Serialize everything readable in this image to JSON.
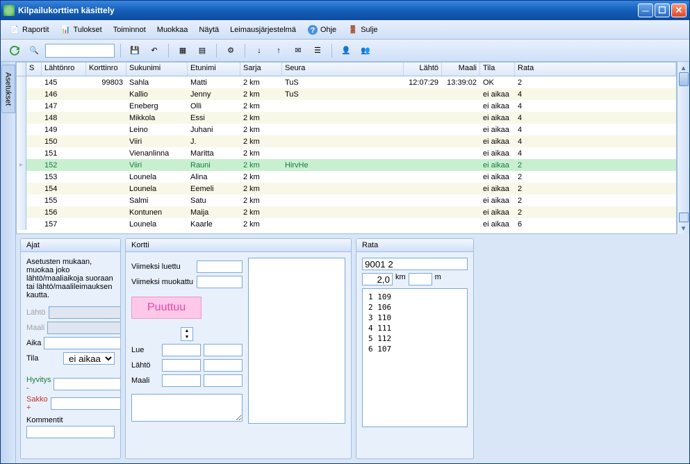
{
  "window": {
    "title": "Kilpailukorttien käsittely"
  },
  "menu": {
    "raportit": "Raportit",
    "tulokset": "Tulokset",
    "toiminnot": "Toiminnot",
    "muokkaa": "Muokkaa",
    "nayta": "Näytä",
    "leimaus": "Leimausjärjestelmä",
    "ohje": "Ohje",
    "sulje": "Sulje"
  },
  "grid": {
    "headers": {
      "s": "S",
      "lahtonro": "Lähtönro",
      "korttinro": "Korttinro",
      "sukunimi": "Sukunimi",
      "etunimi": "Etunimi",
      "sarja": "Sarja",
      "seura": "Seura",
      "lahto": "Lähtö",
      "maali": "Maali",
      "tila": "Tila",
      "rata": "Rata"
    },
    "rows": [
      {
        "lahtonro": "145",
        "korttinro": "99803",
        "sukunimi": "Sahla",
        "etunimi": "Matti",
        "sarja": "2 km",
        "seura": "TuS",
        "lahto": "12:07:29",
        "maali": "13:39:02",
        "tila": "OK",
        "rata": "2"
      },
      {
        "lahtonro": "146",
        "korttinro": "",
        "sukunimi": "Kallio",
        "etunimi": "Jenny",
        "sarja": "2 km",
        "seura": "TuS",
        "lahto": "",
        "maali": "",
        "tila": "ei aikaa",
        "rata": "4"
      },
      {
        "lahtonro": "147",
        "korttinro": "",
        "sukunimi": "Eneberg",
        "etunimi": "Olli",
        "sarja": "2 km",
        "seura": "",
        "lahto": "",
        "maali": "",
        "tila": "ei aikaa",
        "rata": "4"
      },
      {
        "lahtonro": "148",
        "korttinro": "",
        "sukunimi": "Mikkola",
        "etunimi": "Essi",
        "sarja": "2 km",
        "seura": "",
        "lahto": "",
        "maali": "",
        "tila": "ei aikaa",
        "rata": "4"
      },
      {
        "lahtonro": "149",
        "korttinro": "",
        "sukunimi": "Leino",
        "etunimi": "Juhani",
        "sarja": "2 km",
        "seura": "",
        "lahto": "",
        "maali": "",
        "tila": "ei aikaa",
        "rata": "4"
      },
      {
        "lahtonro": "150",
        "korttinro": "",
        "sukunimi": "Viiri",
        "etunimi": "J.",
        "sarja": "2 km",
        "seura": "",
        "lahto": "",
        "maali": "",
        "tila": "ei aikaa",
        "rata": "4"
      },
      {
        "lahtonro": "151",
        "korttinro": "",
        "sukunimi": "Vienanlinna",
        "etunimi": "Maritta",
        "sarja": "2 km",
        "seura": "",
        "lahto": "",
        "maali": "",
        "tila": "ei aikaa",
        "rata": "4"
      },
      {
        "lahtonro": "152",
        "korttinro": "",
        "sukunimi": "Viiri",
        "etunimi": "Rauni",
        "sarja": "2 km",
        "seura": "HirvHe",
        "lahto": "",
        "maali": "",
        "tila": "ei aikaa",
        "rata": "2",
        "selected": true
      },
      {
        "lahtonro": "153",
        "korttinro": "",
        "sukunimi": "Lounela",
        "etunimi": "Alina",
        "sarja": "2 km",
        "seura": "",
        "lahto": "",
        "maali": "",
        "tila": "ei aikaa",
        "rata": "2"
      },
      {
        "lahtonro": "154",
        "korttinro": "",
        "sukunimi": "Lounela",
        "etunimi": "Eemeli",
        "sarja": "2 km",
        "seura": "",
        "lahto": "",
        "maali": "",
        "tila": "ei aikaa",
        "rata": "2"
      },
      {
        "lahtonro": "155",
        "korttinro": "",
        "sukunimi": "Salmi",
        "etunimi": "Satu",
        "sarja": "2 km",
        "seura": "",
        "lahto": "",
        "maali": "",
        "tila": "ei aikaa",
        "rata": "2"
      },
      {
        "lahtonro": "156",
        "korttinro": "",
        "sukunimi": "Kontunen",
        "etunimi": "Maija",
        "sarja": "2 km",
        "seura": "",
        "lahto": "",
        "maali": "",
        "tila": "ei aikaa",
        "rata": "2"
      },
      {
        "lahtonro": "157",
        "korttinro": "",
        "sukunimi": "Lounela",
        "etunimi": "Kaarle",
        "sarja": "2 km",
        "seura": "",
        "lahto": "",
        "maali": "",
        "tila": "ei aikaa",
        "rata": "6"
      }
    ]
  },
  "ajat": {
    "title": "Ajat",
    "info": "Asetusten mukaan, muokaa joko lähtö/maaliaikoja suoraan tai lähtö/maalileimauksen kautta.",
    "lahto_lbl": "Lähtö",
    "maali_lbl": "Maali",
    "aika_lbl": "Aika",
    "tila_lbl": "Tila",
    "tila_val": "ei aikaa",
    "hyvitys_lbl": "Hyvitys -",
    "sakko_lbl": "Sakko +",
    "kommentit_lbl": "Kommentit"
  },
  "kortti": {
    "title": "Kortti",
    "viimeksi_luettu": "Viimeksi luettu",
    "viimeksi_muokattu": "Viimeksi muokattu",
    "puuttuu": "Puuttuu",
    "lue": "Lue",
    "lahto": "Lähtö",
    "maali": "Maali"
  },
  "rata": {
    "title": "Rata",
    "code": "9001 2",
    "km": "2,0",
    "km_unit": "km",
    "m_unit": "m",
    "controls": [
      {
        "n": "1",
        "c": "109"
      },
      {
        "n": "2",
        "c": "106"
      },
      {
        "n": "3",
        "c": "110"
      },
      {
        "n": "4",
        "c": "111"
      },
      {
        "n": "5",
        "c": "112"
      },
      {
        "n": "6",
        "c": "107"
      }
    ]
  },
  "sidebar": {
    "asetukset": "Asetukset"
  }
}
